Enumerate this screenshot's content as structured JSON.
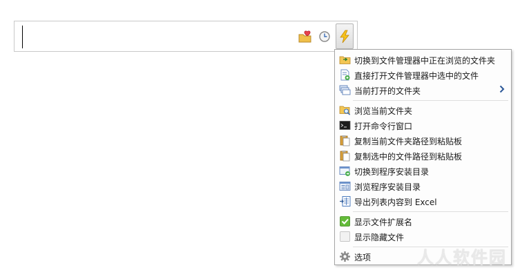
{
  "toolbar": {
    "icons": [
      "favorites-heart-folder-icon",
      "history-clock-icon",
      "lightning-action-icon"
    ]
  },
  "menu": {
    "items": [
      {
        "label": "切换到文件管理器中正在浏览的文件夹",
        "icon": "folder-switch-icon"
      },
      {
        "label": "直接打开文件管理器中选中的文件",
        "icon": "open-file-icon"
      },
      {
        "label": "当前打开的文件夹",
        "icon": "open-folders-icon",
        "submenu": true
      },
      {
        "label": "浏览当前文件夹",
        "icon": "browse-folder-icon"
      },
      {
        "label": "打开命令行窗口",
        "icon": "terminal-icon"
      },
      {
        "label": "复制当前文件夹路径到粘贴板",
        "icon": "clipboard-icon"
      },
      {
        "label": "复制选中的文件路径到粘贴板",
        "icon": "clipboard-icon"
      },
      {
        "label": "切换到程序安装目录",
        "icon": "program-dir-switch-icon"
      },
      {
        "label": "浏览程序安装目录",
        "icon": "program-dir-browse-icon"
      },
      {
        "label": "导出列表内容到 Excel",
        "icon": "export-excel-icon"
      },
      {
        "label": "显示文件扩展名",
        "icon": "checkbox-checked-icon",
        "checked": true
      },
      {
        "label": "显示隐藏文件",
        "icon": "checkbox-unchecked-icon",
        "checked": false
      },
      {
        "label": "选项",
        "icon": "gear-icon"
      }
    ]
  },
  "watermark": "人人软件园",
  "colors": {
    "accent": "#2b5797",
    "check": "#5cb531",
    "separator": "#dedede"
  }
}
